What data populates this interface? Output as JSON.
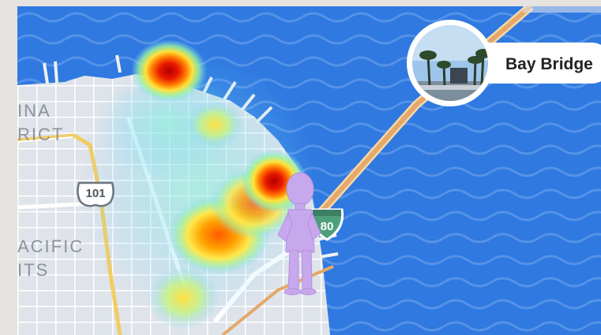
{
  "map": {
    "district_labels": [
      "INA",
      "RICT",
      "ACIFIC",
      "ITS"
    ],
    "highways": [
      {
        "id": "us-101",
        "label": "101",
        "type": "us-route"
      },
      {
        "id": "i-80",
        "label": "80",
        "type": "interstate"
      }
    ],
    "place_story": {
      "label": "Bay Bridge"
    },
    "colors": {
      "water": "#2f79e0",
      "wave": "#5592e8",
      "land": "#dfe3ea",
      "road": "#ffffff",
      "bridge": "#e3a86a",
      "avatar": "#c8a8ec",
      "heat_hot": "#c80000",
      "heat_cool": "#7fd6ff"
    },
    "heatmap_hotspots": [
      {
        "area": "fishermans-wharf",
        "intensity": 1.0
      },
      {
        "area": "embarcadero",
        "intensity": 1.0
      },
      {
        "area": "south-of-market",
        "intensity": 0.7
      },
      {
        "area": "north-beach",
        "intensity": 0.4
      },
      {
        "area": "mission-bay",
        "intensity": 0.35
      }
    ]
  }
}
